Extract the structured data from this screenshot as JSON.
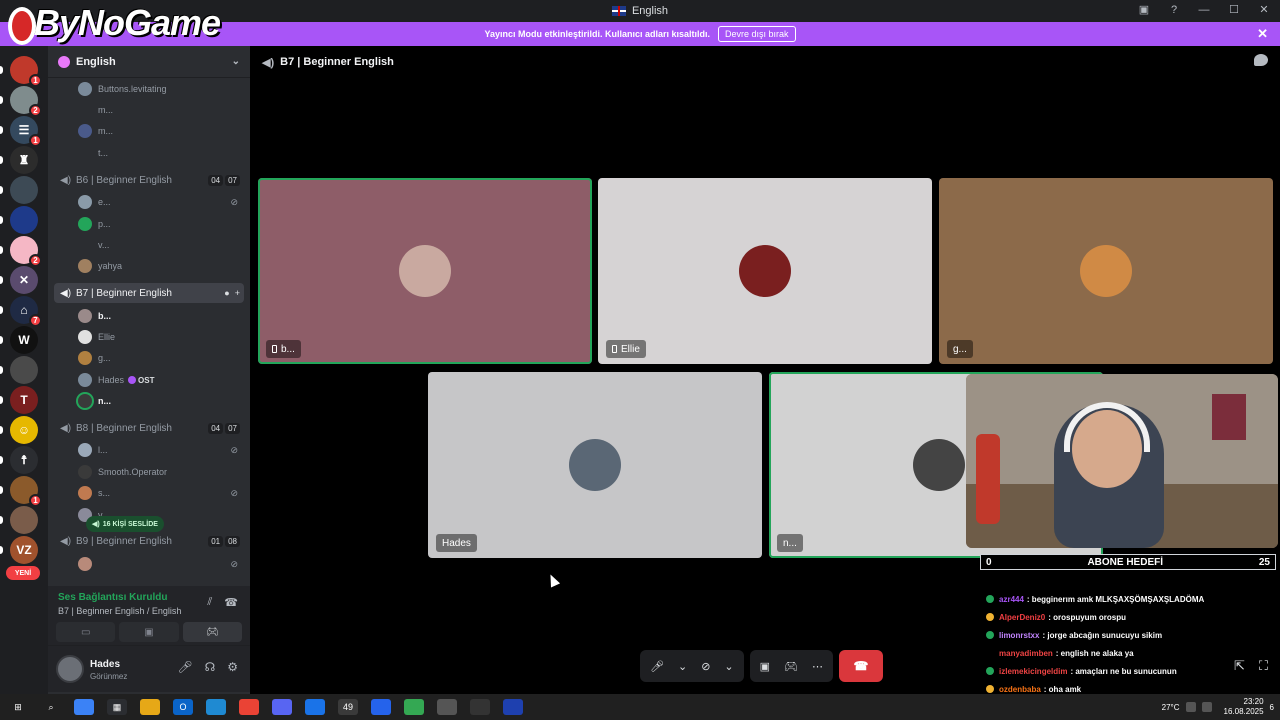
{
  "titlebar": {
    "title": "English"
  },
  "branding": {
    "logo_text": "ByNoGame"
  },
  "banner": {
    "message": "Yayıncı Modu etkinleştirildi. Kullanıcı adları kısaltıldı.",
    "button_label": "Devre dışı bırak"
  },
  "rail": {
    "servers": [
      {
        "name": "server-1",
        "badge": "1",
        "color": "#c0392b",
        "glyph": ""
      },
      {
        "name": "server-2",
        "badge": "2",
        "color": "#7f8c8d",
        "glyph": ""
      },
      {
        "name": "server-3",
        "badge": "1",
        "color": "#34495e",
        "glyph": "☰"
      },
      {
        "name": "server-4",
        "badge": "",
        "color": "#2c2c2c",
        "glyph": "♜"
      },
      {
        "name": "server-5",
        "badge": "",
        "color": "#3d4a55",
        "glyph": ""
      },
      {
        "name": "server-english",
        "badge": "",
        "color": "#1e3a8a",
        "glyph": ""
      },
      {
        "name": "server-7",
        "badge": "2",
        "color": "#f5b7c5",
        "glyph": ""
      },
      {
        "name": "server-8",
        "badge": "",
        "color": "#5a4b6e",
        "glyph": "✕"
      },
      {
        "name": "server-9",
        "badge": "7",
        "color": "#1f2a44",
        "glyph": "⌂"
      },
      {
        "name": "server-w",
        "badge": "",
        "color": "#111111",
        "glyph": "W"
      },
      {
        "name": "server-11",
        "badge": "",
        "color": "#4a4a4a",
        "glyph": ""
      },
      {
        "name": "server-tdr",
        "badge": "",
        "color": "#7a1f1f",
        "glyph": "T"
      },
      {
        "name": "server-13",
        "badge": "",
        "color": "#e6b800",
        "glyph": "☺"
      },
      {
        "name": "server-14",
        "badge": "",
        "color": "#2b2d31",
        "glyph": "☨"
      },
      {
        "name": "server-15",
        "badge": "1",
        "color": "#8b5a2b",
        "glyph": ""
      },
      {
        "name": "server-16",
        "badge": "",
        "color": "#7a5c4a",
        "glyph": ""
      },
      {
        "name": "server-vz",
        "badge": "",
        "color": "#a0522d",
        "glyph": "VZ"
      }
    ],
    "new_label": "YENİ"
  },
  "sidebar": {
    "guild_name": "English",
    "channels": [
      {
        "name": "B6 | Beginner English",
        "count_a": "04",
        "count_b": "07"
      },
      {
        "name": "B7 | Beginner English"
      },
      {
        "name": "B8 | Beginner English",
        "count_a": "04",
        "count_b": "07"
      },
      {
        "name": "B9 | Beginner English",
        "count_a": "01",
        "count_b": "08"
      }
    ],
    "members_prev": [
      "Buttons.levitating",
      "m...",
      "m...",
      "t..."
    ],
    "members_b6": [
      "e...",
      "p...",
      "v...",
      "yahya"
    ],
    "members_b7": [
      "b...",
      "Ellie",
      "g...",
      "Hades",
      "n..."
    ],
    "ost_badge": "OST",
    "members_b8": [
      "l...",
      "Smooth.Operator",
      "s...",
      "v..."
    ],
    "live_pill": "16 KİŞİ SESLİDE"
  },
  "voice_panel": {
    "status": "Ses Bağlantısı Kuruldu",
    "channel": "B7 | Beginner English / English"
  },
  "user_panel": {
    "name": "Hades",
    "status": "Görünmez"
  },
  "stage": {
    "channel_title": "B7 | Beginner English",
    "tiles": [
      {
        "name": "b...",
        "bg": "#8e5d68",
        "avatar": "#c9a9a0",
        "speaking": true,
        "mobile": true
      },
      {
        "name": "Ellie",
        "bg": "#d6d3d4",
        "avatar": "#7a1f1f",
        "speaking": false,
        "mobile": true
      },
      {
        "name": "g...",
        "bg": "#8c6a4a",
        "avatar": "#d08a45",
        "speaking": false,
        "mobile": false
      },
      {
        "name": "Hades",
        "bg": "#c6c6c8",
        "avatar": "#5a6775",
        "speaking": false,
        "mobile": false
      },
      {
        "name": "n...",
        "bg": "#d2d2d2",
        "avatar": "#444444",
        "speaking": true,
        "mobile": false
      }
    ]
  },
  "overlay": {
    "abone_left": "0",
    "abone_title": "ABONE HEDEFİ",
    "abone_right": "25",
    "chat": [
      {
        "user": "azr444",
        "text": ": begginerım amk MLKŞAXŞÖMŞAXŞLADÖMA",
        "color": "#a855f7",
        "icon": "#23a55a"
      },
      {
        "user": "AlperDeniz0",
        "text": ": orospuyum orospu",
        "color": "#f23f43",
        "icon": "#f0b232"
      },
      {
        "user": "limonrstxx",
        "text": ": jorge abcağın sunucuyu sikim",
        "color": "#c084fc",
        "icon": "#23a55a"
      },
      {
        "user": "manyadimben",
        "text": ": english ne alaka ya",
        "color": "#ef4444",
        "icon": "#000000"
      },
      {
        "user": "izlemekicingeldim",
        "text": ": amaçları ne bu sunucunun",
        "color": "#ef4444",
        "icon": "#23a55a"
      },
      {
        "user": "ozdenbaba",
        "text": ": oha amk",
        "color": "#f97316",
        "icon": "#f0b232"
      }
    ]
  },
  "taskbar": {
    "badge_count": "49",
    "weather": "27°C",
    "time": "23:20",
    "date": "16.08.2025",
    "notif": "6"
  }
}
